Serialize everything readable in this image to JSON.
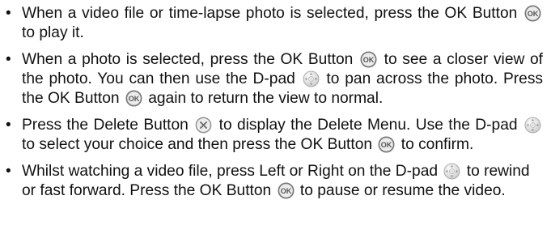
{
  "items": [
    {
      "parts": [
        "When a video file or time-lapse photo is selected, press the OK Button",
        "to play it."
      ]
    },
    {
      "parts": [
        "When a photo is selected, press the OK Button",
        "to see a closer view of the photo. You can then use the D-pad",
        "to pan across the photo. Press the OK Button",
        "again to return the view to normal."
      ]
    },
    {
      "parts": [
        "Press the Delete Button",
        "to display the Delete Menu. Use the D-pad",
        "to select your choice and then press the OK Button",
        "to confirm."
      ]
    },
    {
      "parts": [
        "Whilst watching a video file, press Left or Right on the D-pad",
        "to rewind or fast forward. Press the OK Button",
        "to pause or resume the video."
      ]
    }
  ],
  "icons": {
    "ok_label": "OK"
  },
  "colors": {
    "text": "#111111",
    "icon_ring": "#7a7a7a",
    "icon_fill": "#ececec"
  }
}
